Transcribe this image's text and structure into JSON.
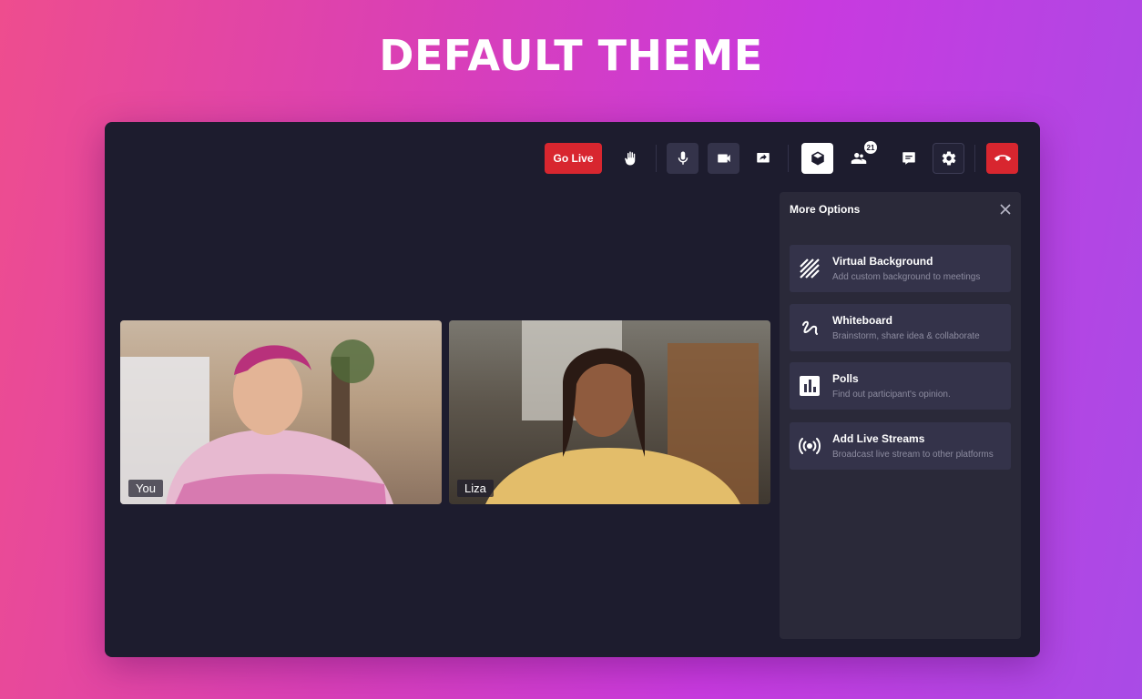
{
  "hero": {
    "title": "DEFAULT THEME"
  },
  "toolbar": {
    "go_live_label": "Go Live",
    "participants_count": "21",
    "icons": {
      "hand": "raise-hand-icon",
      "mic": "microphone-icon",
      "camera": "video-camera-icon",
      "share": "screen-share-icon",
      "more": "cube-icon",
      "participants": "people-icon",
      "chat": "chat-icon",
      "settings": "gear-icon",
      "leave": "phone-hangup-icon"
    }
  },
  "participants": [
    {
      "name": "You"
    },
    {
      "name": "Liza"
    }
  ],
  "more_options": {
    "title": "More Options",
    "items": [
      {
        "title": "Virtual Background",
        "description": "Add custom background to meetings",
        "icon": "striped-background-icon"
      },
      {
        "title": "Whiteboard",
        "description": "Brainstorm, share idea & collaborate",
        "icon": "squiggle-icon"
      },
      {
        "title": "Polls",
        "description": "Find out participant's opinion.",
        "icon": "bar-chart-icon"
      },
      {
        "title": "Add Live Streams",
        "description": "Broadcast live stream to other platforms",
        "icon": "broadcast-icon"
      }
    ]
  },
  "colors": {
    "window_bg": "#1d1c2e",
    "panel_bg": "#2a2939",
    "danger": "#d8262f",
    "background_gradient_start": "#ee4d8e",
    "background_gradient_end": "#a94be6"
  }
}
